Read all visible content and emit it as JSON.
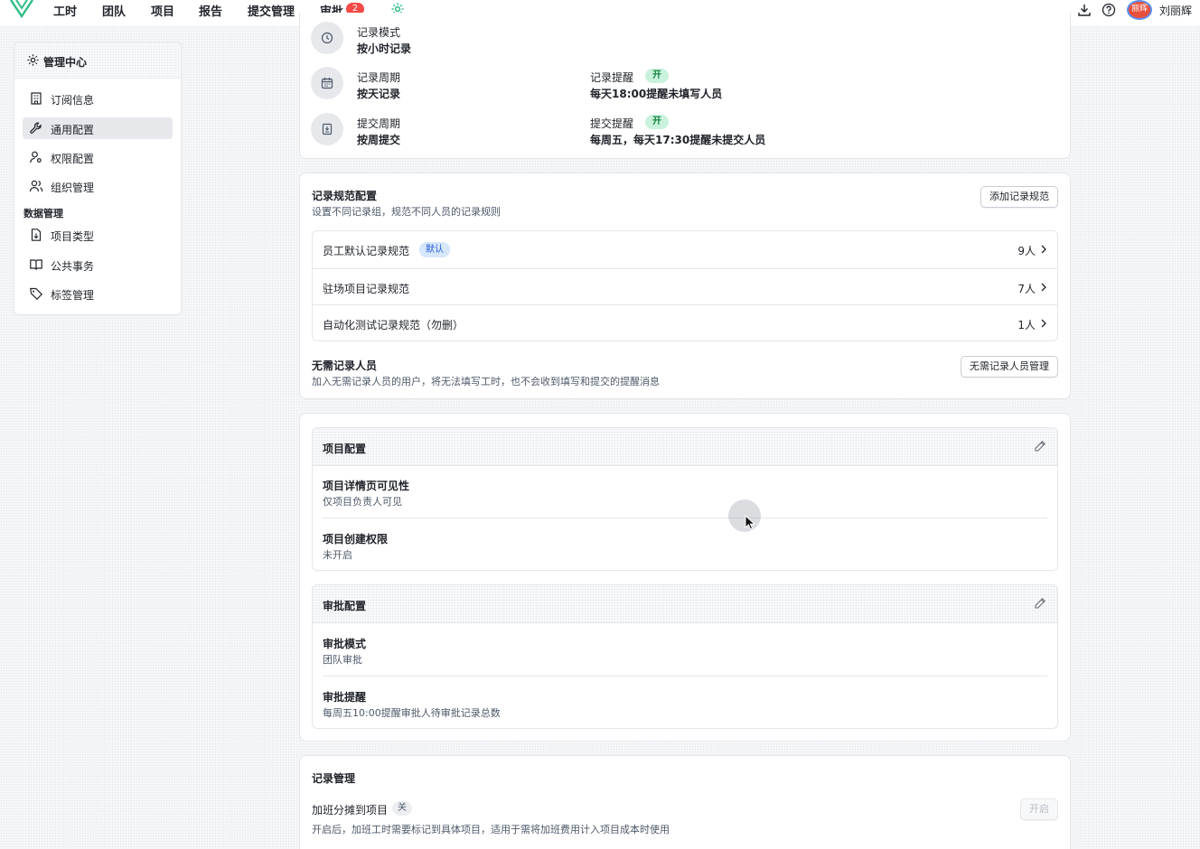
{
  "nav": {
    "items": [
      "工时",
      "团队",
      "项目",
      "报告",
      "提交管理",
      "审批"
    ],
    "approval_badge": "2",
    "user_name": "刘丽辉",
    "avatar_text": "丽辉"
  },
  "sidebar": {
    "title": "管理中心",
    "items": [
      {
        "label": "订阅信息",
        "icon": "building-icon"
      },
      {
        "label": "通用配置",
        "icon": "wrench-icon"
      },
      {
        "label": "权限配置",
        "icon": "user-key-icon"
      },
      {
        "label": "组织管理",
        "icon": "users-icon"
      }
    ],
    "group_label": "数据管理",
    "group_items": [
      {
        "label": "项目类型",
        "icon": "file-icon"
      },
      {
        "label": "公共事务",
        "icon": "book-icon"
      },
      {
        "label": "标签管理",
        "icon": "tag-icon"
      }
    ],
    "active_item": "通用配置"
  },
  "record_settings": {
    "mode_label": "记录模式",
    "mode_value": "按小时记录",
    "cycle_label": "记录周期",
    "cycle_value": "按天记录",
    "record_reminder_label": "记录提醒",
    "record_reminder_state": "开",
    "record_reminder_value": "每天18:00提醒未填写人员",
    "submit_cycle_label": "提交周期",
    "submit_cycle_value": "按周提交",
    "submit_reminder_label": "提交提醒",
    "submit_reminder_state": "开",
    "submit_reminder_value": "每周五，每天17:30提醒未提交人员"
  },
  "record_rules": {
    "title": "记录规范配置",
    "subtitle": "设置不同记录组，规范不同人员的记录规则",
    "add_button": "添加记录规范",
    "default_tag": "默认",
    "rules": [
      {
        "name": "员工默认记录规范",
        "count": "9人"
      },
      {
        "name": "驻场项目记录规范",
        "count": "7人"
      },
      {
        "name": "自动化测试记录规范（勿删）",
        "count": "1人"
      }
    ],
    "exempt_title": "无需记录人员",
    "exempt_desc": "加入无需记录人员的用户，将无法填写工时，也不会收到填写和提交的提醒消息",
    "exempt_button": "无需记录人员管理"
  },
  "project_config": {
    "title": "项目配置",
    "visibility_label": "项目详情页可见性",
    "visibility_value": "仅项目负责人可见",
    "create_label": "项目创建权限",
    "create_value": "未开启"
  },
  "approval_config": {
    "title": "审批配置",
    "mode_label": "审批模式",
    "mode_value": "团队审批",
    "reminder_label": "审批提醒",
    "reminder_value": "每周五10:00提醒审批人待审批记录总数"
  },
  "record_management": {
    "title": "记录管理",
    "overtime_label": "加班分摊到项目",
    "overtime_state": "关",
    "overtime_desc": "开启后，加班工时需要标记到具体项目，适用于需将加班费用计入项目成本时使用",
    "enable_button": "开启"
  }
}
